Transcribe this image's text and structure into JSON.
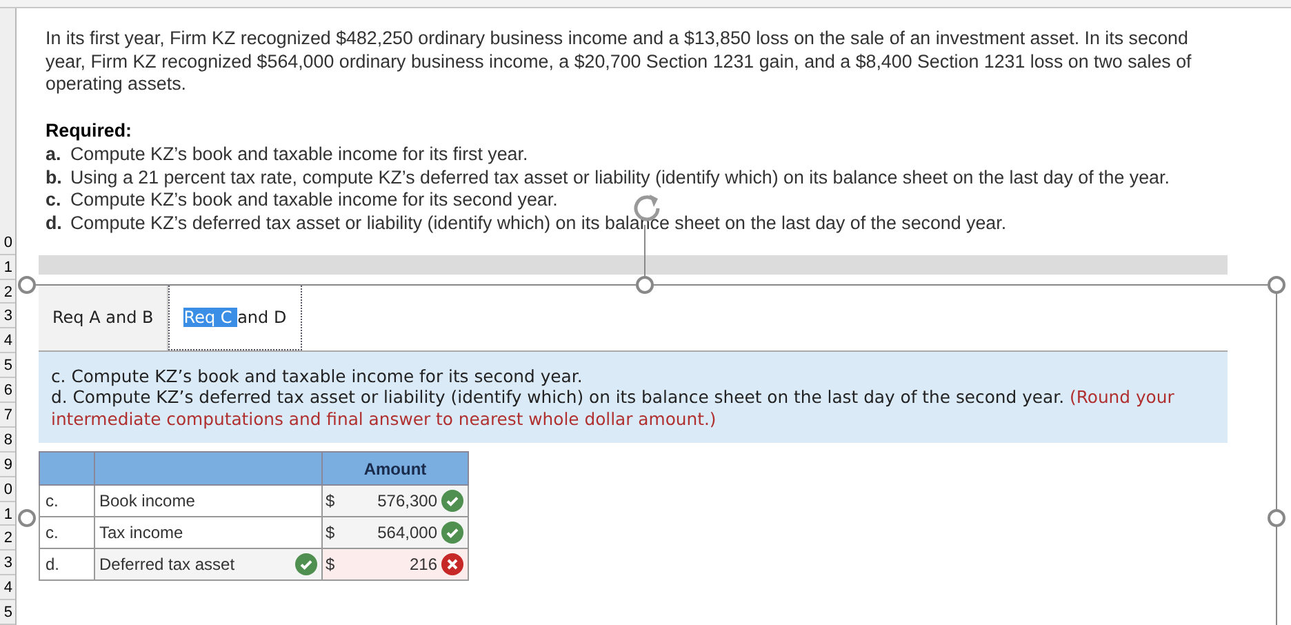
{
  "spreadsheet": {
    "row_numbers": [
      "0",
      "1",
      "2",
      "3",
      "4",
      "5",
      "6",
      "7",
      "8",
      "9",
      "0",
      "1",
      "2",
      "3",
      "4",
      "5"
    ]
  },
  "problem": {
    "intro": "In its first year, Firm KZ recognized $482,250 ordinary business income and a $13,850 loss on the sale of an investment asset. In its second year, Firm KZ recognized $564,000 ordinary business income, a $20,700 Section 1231 gain, and a $8,400 Section 1231 loss on two sales of operating assets.",
    "required_heading": "Required:",
    "required": [
      {
        "marker": "a.",
        "text": "Compute KZ’s book and taxable income for its first year."
      },
      {
        "marker": "b.",
        "text": "Using a 21 percent tax rate, compute KZ’s deferred tax asset or liability (identify which) on its balance sheet on the last day of the year."
      },
      {
        "marker": "c.",
        "text": "Compute KZ’s book and taxable income for its second year."
      },
      {
        "marker": "d.",
        "text": "Compute KZ’s deferred tax asset or liability (identify which) on its balance sheet on the last day of the second year."
      }
    ]
  },
  "tabs": [
    {
      "selected": false,
      "parts": [
        {
          "text": "Req A and B",
          "highlighted": false
        }
      ]
    },
    {
      "selected": true,
      "parts": [
        {
          "text": "Req C ",
          "highlighted": true
        },
        {
          "text": "and D",
          "highlighted": false
        }
      ]
    }
  ],
  "instructions": {
    "lines": [
      "c. Compute KZ’s book and taxable income for its second year.",
      "d. Compute KZ’s deferred tax asset or liability (identify which) on its balance sheet on the last day of the second year."
    ],
    "note": "(Round your intermediate computations and final answer to nearest whole dollar amount.)"
  },
  "table": {
    "columns": [
      "Amount"
    ],
    "rows": [
      {
        "part": "c.",
        "label": "Book income",
        "label_checked": false,
        "currency": "$",
        "amount": "576,300",
        "correct": true
      },
      {
        "part": "c.",
        "label": "Tax income",
        "label_checked": false,
        "currency": "$",
        "amount": "564,000",
        "correct": true
      },
      {
        "part": "d.",
        "label": "Deferred tax asset",
        "label_checked": true,
        "currency": "$",
        "amount": "216",
        "correct": false
      }
    ]
  }
}
